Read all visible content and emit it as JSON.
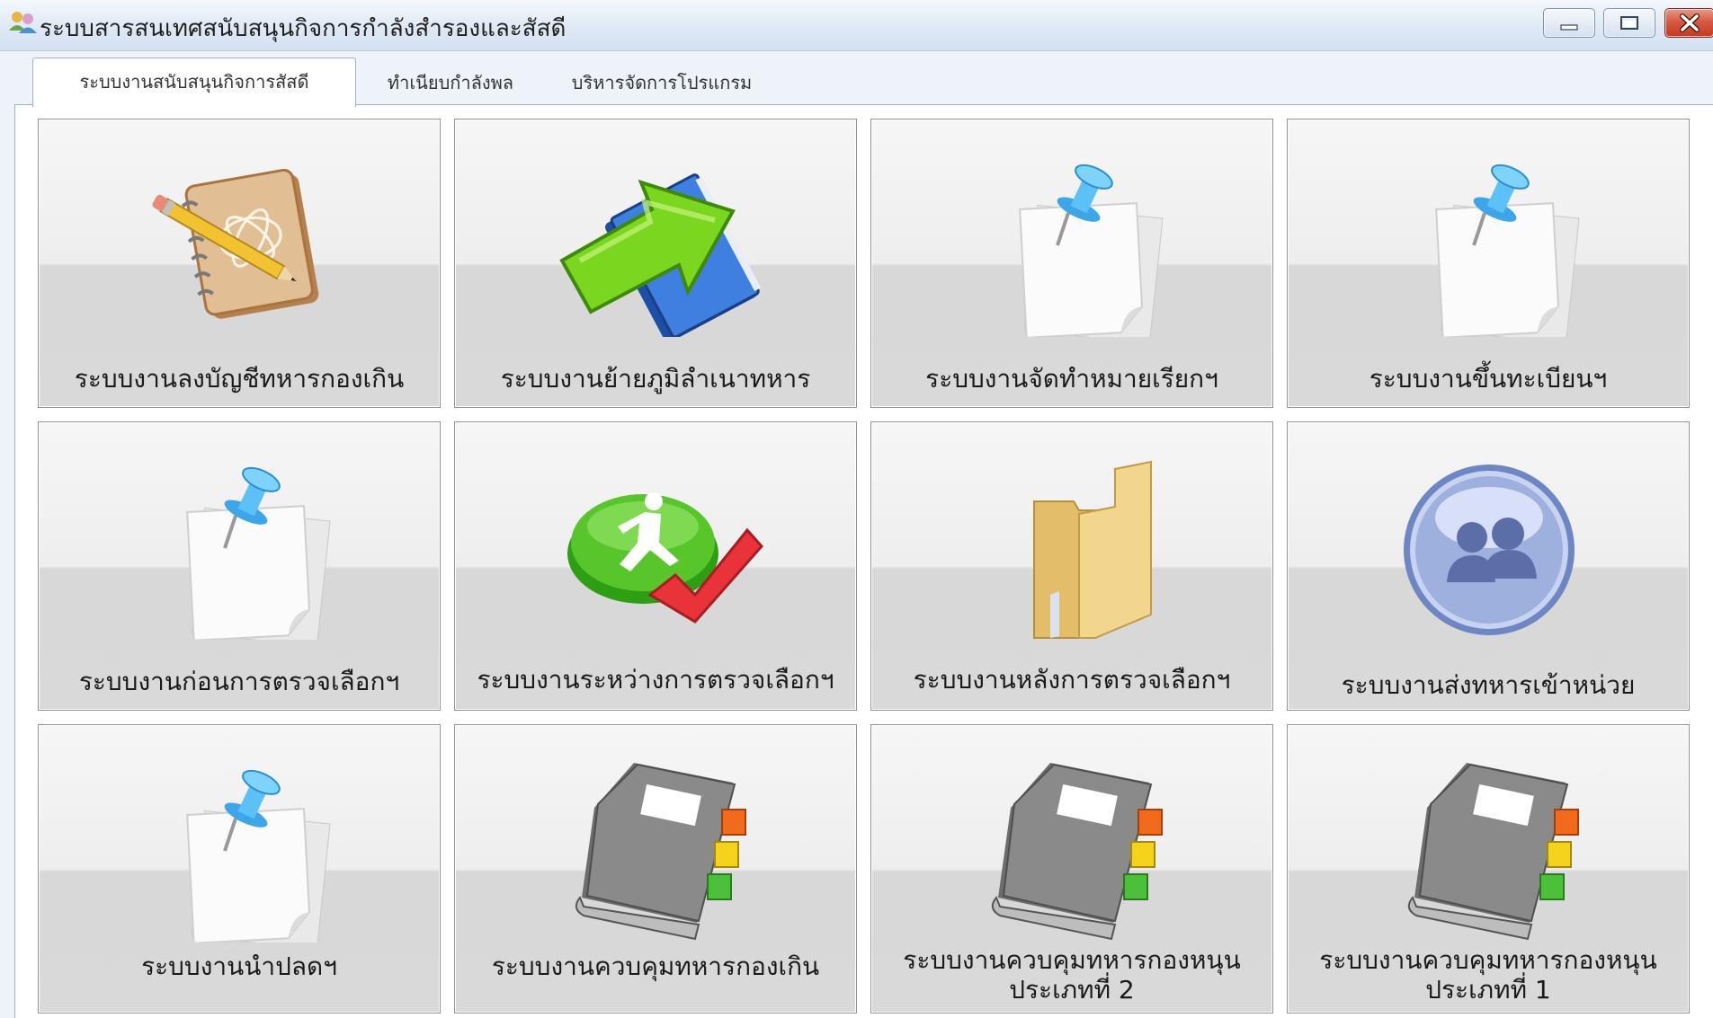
{
  "window": {
    "title": "ระบบสารสนเทศสนับสนุนกิจการกำลังสำรองและสัสดี",
    "controls": [
      "minimize",
      "maximize",
      "close"
    ]
  },
  "tabs": [
    {
      "label": "ระบบงานสนับสนุนกิจการสัสดี",
      "active": true
    },
    {
      "label": "ทำเนียบกำลังพล",
      "active": false
    },
    {
      "label": "บริหารจัดการโปรแกรม",
      "active": false
    }
  ],
  "tiles": [
    {
      "label": "ระบบงานลงบัญชีทหารกองเกิน",
      "icon": "notebook-pencil-icon"
    },
    {
      "label": "ระบบงานย้ายภูมิลำเนาทหาร",
      "icon": "arrow-book-icon"
    },
    {
      "label": "ระบบงานจัดทำหมายเรียกฯ",
      "icon": "pinned-note-icon"
    },
    {
      "label": "ระบบงานขึ้นทะเบียนฯ",
      "icon": "pinned-note-icon"
    },
    {
      "label": "ระบบงานก่อนการตรวจเลือกฯ",
      "icon": "pinned-note-icon"
    },
    {
      "label": "ระบบงานระหว่างการตรวจเลือกฯ",
      "icon": "runner-check-icon"
    },
    {
      "label": "ระบบงานหลังการตรวจเลือกฯ",
      "icon": "folder-icon"
    },
    {
      "label": "ระบบงานส่งทหารเข้าหน่วย",
      "icon": "users-orb-icon"
    },
    {
      "label": "ระบบงานนำปลดฯ",
      "icon": "pinned-note-icon"
    },
    {
      "label": "ระบบงานควบคุมทหารกองเกิน",
      "icon": "gray-book-icon"
    },
    {
      "label": "ระบบงานควบคุมทหารกองหนุน\nประเภทที่ 2",
      "icon": "gray-book-icon"
    },
    {
      "label": "ระบบงานควบคุมทหารกองหนุน\nประเภทที่ 1",
      "icon": "gray-book-icon"
    }
  ]
}
